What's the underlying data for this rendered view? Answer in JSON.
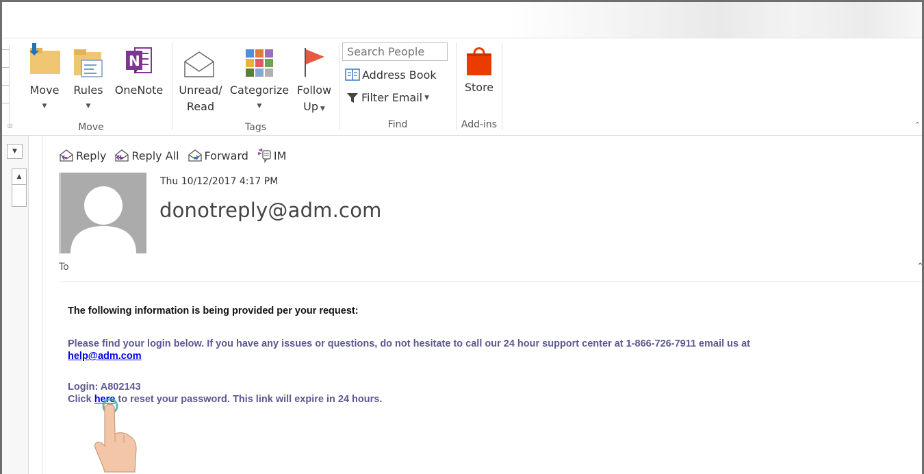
{
  "ribbon": {
    "move_group": {
      "label": "Move",
      "buttons": [
        {
          "label": "Move",
          "icon": "move-folder-icon"
        },
        {
          "label": "Rules",
          "icon": "rules-icon"
        },
        {
          "label": "OneNote",
          "icon": "onenote-icon"
        }
      ]
    },
    "tags_group": {
      "label": "Tags",
      "buttons": [
        {
          "label_line1": "Unread/",
          "label_line2": "Read",
          "icon": "envelope-icon"
        },
        {
          "label": "Categorize",
          "icon": "categorize-icon"
        },
        {
          "label_line1": "Follow",
          "label_line2": "Up",
          "icon": "flag-icon"
        }
      ]
    },
    "find_group": {
      "label": "Find",
      "search_placeholder": "Search People",
      "address_book": "Address Book",
      "filter_email": "Filter Email"
    },
    "addins_group": {
      "label": "Add-ins",
      "store": "Store"
    }
  },
  "message": {
    "actions": {
      "reply": "Reply",
      "reply_all": "Reply All",
      "forward": "Forward",
      "im": "IM"
    },
    "datetime": "Thu 10/12/2017 4:17 PM",
    "sender": "donotreply@adm.com",
    "to_label": "To",
    "body": {
      "intro": "The following information is being provided per your request:",
      "support_text": "Please find your login below. If you have any issues or questions, do not hesitate to call our 24 hour support center at 1-866-726-7911 email us at",
      "support_email": "help@adm.com",
      "login": "Login: A802143",
      "click_prefix": "Click",
      "link_text": "here",
      "click_suffix": "to reset your password. This link will expire in 24 hours."
    }
  },
  "colors": {
    "body_purple": "#5c5891",
    "link_blue": "#0000ee",
    "store_orange": "#eb3c00",
    "onenote_purple": "#7c3790",
    "flag_red": "#e55b3f"
  }
}
